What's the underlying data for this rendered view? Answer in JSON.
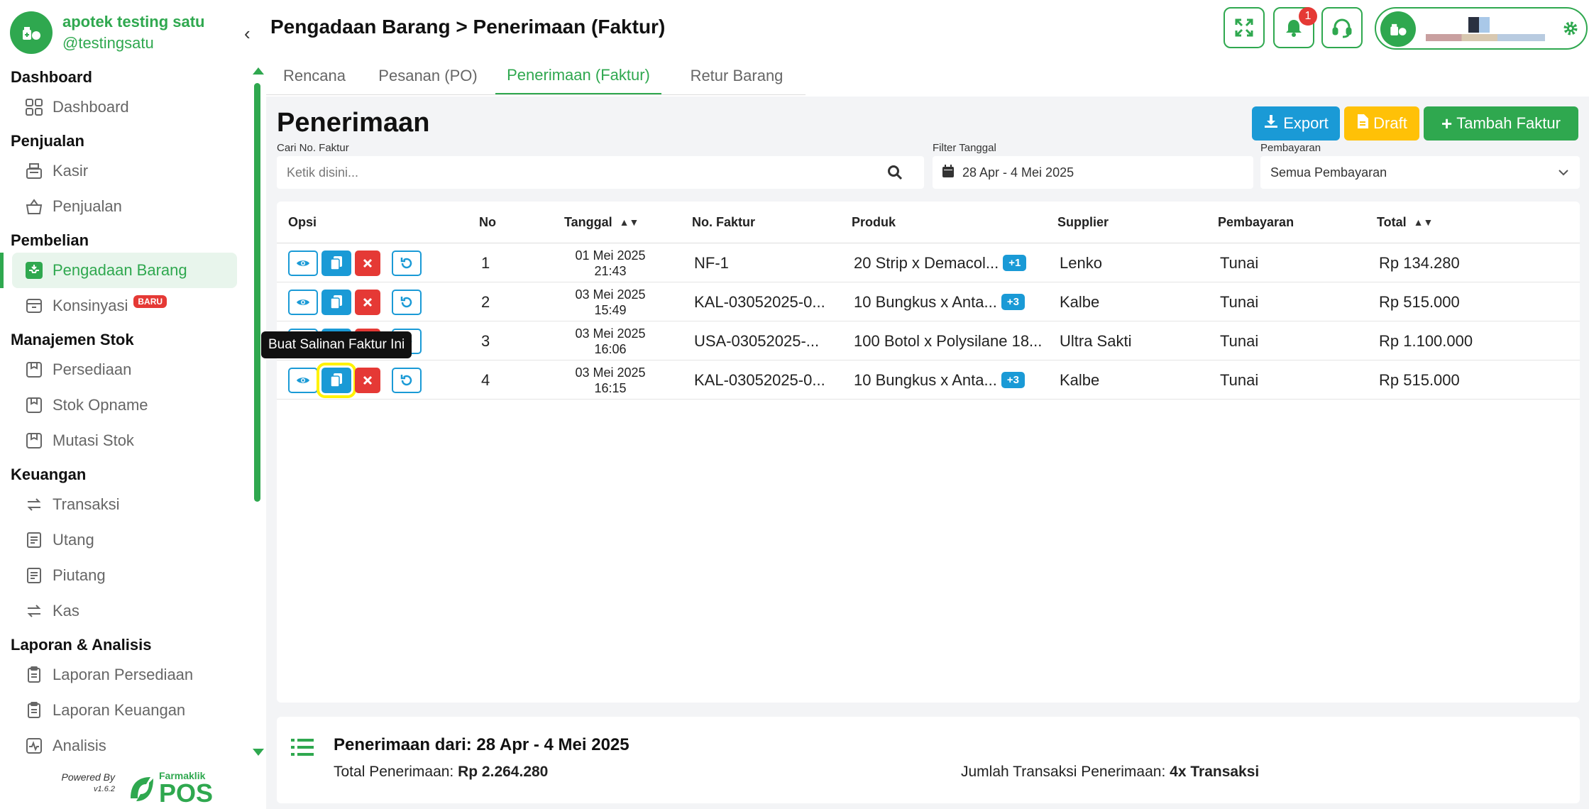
{
  "brand": {
    "name": "apotek testing satu",
    "username": "@testingsatu"
  },
  "nav": {
    "sections": [
      {
        "title": "Dashboard",
        "items": [
          {
            "label": "Dashboard",
            "icon": "grid-icon"
          }
        ]
      },
      {
        "title": "Penjualan",
        "items": [
          {
            "label": "Kasir",
            "icon": "cash-register-icon"
          },
          {
            "label": "Penjualan",
            "icon": "basket-icon"
          }
        ]
      },
      {
        "title": "Pembelian",
        "items": [
          {
            "label": "Pengadaan Barang",
            "icon": "inbox-icon",
            "active": true
          },
          {
            "label": "Konsinyasi",
            "icon": "archive-icon",
            "badge": "BARU"
          }
        ]
      },
      {
        "title": "Manajemen Stok",
        "items": [
          {
            "label": "Persediaan",
            "icon": "box-icon"
          },
          {
            "label": "Stok Opname",
            "icon": "box-icon"
          },
          {
            "label": "Mutasi Stok",
            "icon": "box-icon"
          }
        ]
      },
      {
        "title": "Keuangan",
        "items": [
          {
            "label": "Transaksi",
            "icon": "transfer-icon"
          },
          {
            "label": "Utang",
            "icon": "receipt-icon"
          },
          {
            "label": "Piutang",
            "icon": "receipt-icon"
          },
          {
            "label": "Kas",
            "icon": "transfer-icon"
          }
        ]
      },
      {
        "title": "Laporan & Analisis",
        "items": [
          {
            "label": "Laporan Persediaan",
            "icon": "clipboard-icon"
          },
          {
            "label": "Laporan Keuangan",
            "icon": "clipboard-icon"
          },
          {
            "label": "Analisis",
            "icon": "activity-icon"
          }
        ]
      }
    ]
  },
  "footer": {
    "powered_by": "Powered By",
    "version": "v1.6.2",
    "logo_small": "Farmaklik",
    "logo_big": "POS"
  },
  "header": {
    "title": "Pengadaan Barang > Penerimaan (Faktur)",
    "notification_count": "1"
  },
  "tabs": [
    "Rencana",
    "Pesanan (PO)",
    "Penerimaan (Faktur)",
    "Retur Barang"
  ],
  "main": {
    "title": "Penerimaan",
    "buttons": {
      "export": "Export",
      "draft": "Draft",
      "add": "Tambah Faktur"
    },
    "search": {
      "label": "Cari No. Faktur",
      "placeholder": "Ketik disini..."
    },
    "date_filter": {
      "label": "Filter Tanggal",
      "value": "28 Apr - 4 Mei 2025"
    },
    "payment_filter": {
      "label": "Pembayaran",
      "value": "Semua Pembayaran"
    }
  },
  "table": {
    "headers": {
      "opsi": "Opsi",
      "no": "No",
      "tanggal": "Tanggal",
      "faktur": "No. Faktur",
      "produk": "Produk",
      "supplier": "Supplier",
      "pembayaran": "Pembayaran",
      "total": "Total"
    },
    "rows": [
      {
        "no": "1",
        "date": "01 Mei 2025",
        "time": "21:43",
        "faktur": "NF-1",
        "produk": "20 Strip x Demacol...",
        "extra": "+1",
        "supplier": "Lenko",
        "payment": "Tunai",
        "total": "Rp 134.280"
      },
      {
        "no": "2",
        "date": "03 Mei 2025",
        "time": "15:49",
        "faktur": "KAL-03052025-0...",
        "produk": "10 Bungkus x Anta...",
        "extra": "+3",
        "supplier": "Kalbe",
        "payment": "Tunai",
        "total": "Rp 515.000"
      },
      {
        "no": "3",
        "date": "03 Mei 2025",
        "time": "16:06",
        "faktur": "USA-03052025-...",
        "produk": "100 Botol x Polysilane 18...",
        "extra": "",
        "supplier": "Ultra Sakti",
        "payment": "Tunai",
        "total": "Rp 1.100.000"
      },
      {
        "no": "4",
        "date": "03 Mei 2025",
        "time": "16:15",
        "faktur": "KAL-03052025-0...",
        "produk": "10 Bungkus x Anta...",
        "extra": "+3",
        "supplier": "Kalbe",
        "payment": "Tunai",
        "total": "Rp 515.000"
      }
    ]
  },
  "tooltip": "Buat Salinan Faktur Ini",
  "summary": {
    "title": "Penerimaan dari: 28 Apr - 4 Mei 2025",
    "total_label": "Total Penerimaan:",
    "total_value": "Rp 2.264.280",
    "count_label": "Jumlah Transaksi Penerimaan:",
    "count_value": "4x Transaksi"
  },
  "colors": {
    "primary": "#2fa84f",
    "info": "#1a9ad6",
    "warning": "#ffc107",
    "danger": "#e53935"
  }
}
